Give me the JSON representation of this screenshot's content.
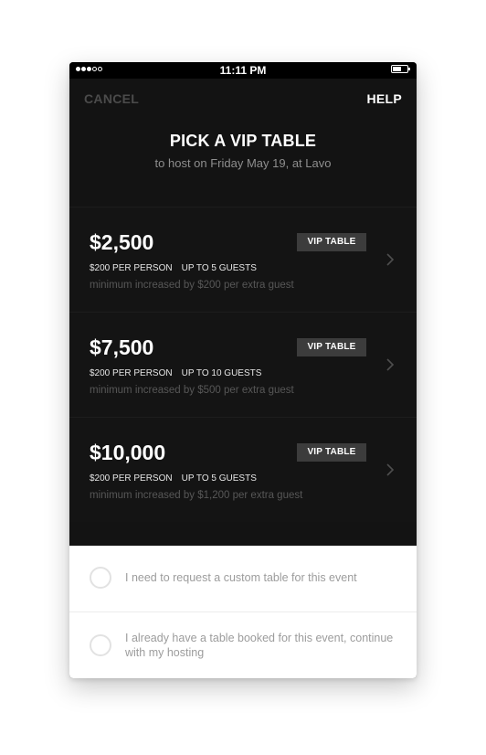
{
  "status_bar": {
    "time": "11:11 PM",
    "signal_bars_filled": 3,
    "signal_bars_total": 5,
    "battery_level": 0.5
  },
  "nav": {
    "cancel_label": "CANCEL",
    "help_label": "HELP"
  },
  "header": {
    "title": "PICK A VIP TABLE",
    "subtitle": "to host on Friday May 19, at Lavo"
  },
  "tables": [
    {
      "price": "$2,500",
      "badge": "VIP TABLE",
      "per_person": "$200 PER PERSON",
      "guests": "UP TO 5 GUESTS",
      "minimum_note": "minimum increased by $200 per extra guest"
    },
    {
      "price": "$7,500",
      "badge": "VIP TABLE",
      "per_person": "$200 PER PERSON",
      "guests": "UP TO 10 GUESTS",
      "minimum_note": "minimum increased by $500 per extra guest"
    },
    {
      "price": "$10,000",
      "badge": "VIP TABLE",
      "per_person": "$200 PER PERSON",
      "guests": "UP TO 5 GUESTS",
      "minimum_note": "minimum increased by $1,200 per extra guest"
    }
  ],
  "options": [
    {
      "label": "I need to request a custom table for this event",
      "checked": false
    },
    {
      "label": "I already have a table booked for this event, continue with my hosting",
      "checked": false
    }
  ],
  "icons": {
    "row_arrow": "chevron-right-icon",
    "choice": "radio-circle-icon"
  },
  "colors": {
    "background_dark": "#131313",
    "badge": "#3c3c3c",
    "text_primary": "#ffffff",
    "text_muted": "#575757",
    "sheet": "#ffffff"
  }
}
